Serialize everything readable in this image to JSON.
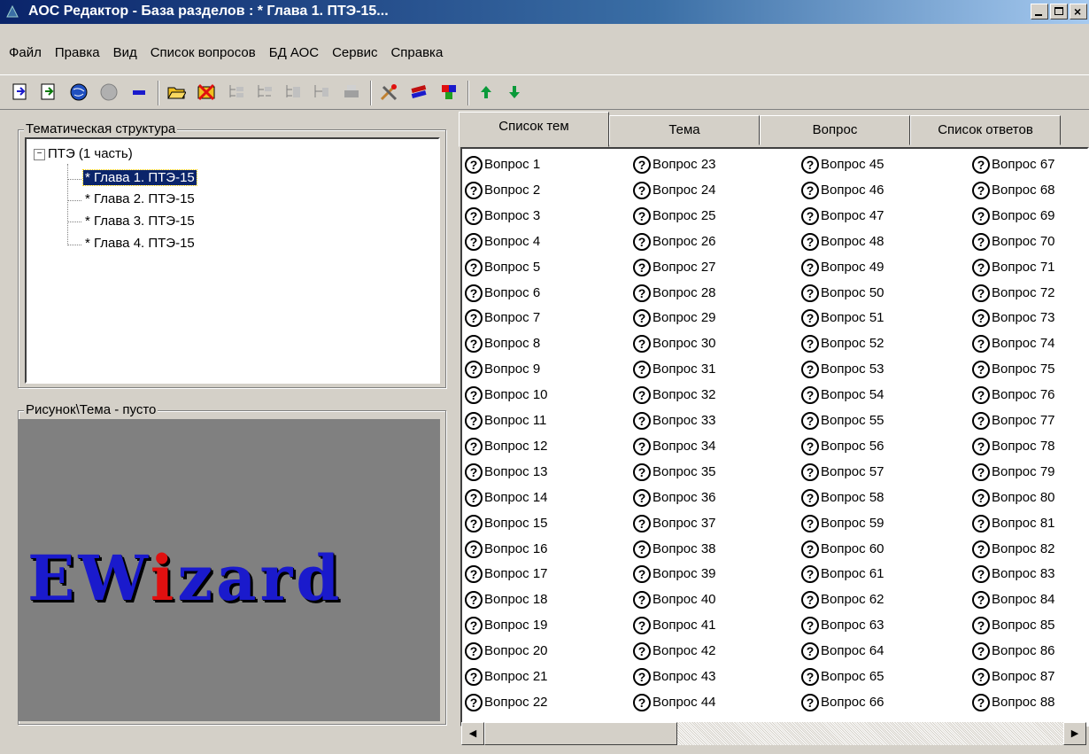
{
  "window": {
    "title": "АОС Редактор - База разделов : * Глава 1. ПТЭ-15..."
  },
  "menu": [
    "Файл",
    "Правка",
    "Вид",
    "Список вопросов",
    "БД АОС",
    "Сервис",
    "Справка"
  ],
  "toolbar_icons": [
    "import-icon",
    "export-icon",
    "globe-icon",
    "globe-disabled-icon",
    "minus-icon",
    "open-folder-icon",
    "delete-icon",
    "tree-add-icon",
    "tree-move-icon",
    "tree-indent-icon",
    "tree-outdent-icon",
    "print-icon",
    "tools-icon",
    "books-icon",
    "colors-icon",
    "arrow-up-icon",
    "arrow-down-icon"
  ],
  "left": {
    "tree_caption": "Тематическая структура",
    "tree": {
      "root": "ПТЭ (1 часть)",
      "children": [
        "* Глава 1. ПТЭ-15",
        "* Глава 2. ПТЭ-15",
        "* Глава 3. ПТЭ-15",
        "* Глава 4. ПТЭ-15"
      ],
      "selected_index": 0
    },
    "picture_caption": "Рисунок\\Тема  - пусто",
    "logo": {
      "part1": "EW",
      "part2": "i",
      "part3": "zard"
    }
  },
  "tabs": [
    "Список тем",
    "Тема",
    "Вопрос",
    "Список ответов"
  ],
  "active_tab": 0,
  "questions": [
    "Вопрос 1",
    "Вопрос 2",
    "Вопрос 3",
    "Вопрос 4",
    "Вопрос 5",
    "Вопрос 6",
    "Вопрос 7",
    "Вопрос 8",
    "Вопрос 9",
    "Вопрос 10",
    "Вопрос 11",
    "Вопрос 12",
    "Вопрос 13",
    "Вопрос 14",
    "Вопрос 15",
    "Вопрос 16",
    "Вопрос 17",
    "Вопрос 18",
    "Вопрос 19",
    "Вопрос 20",
    "Вопрос 21",
    "Вопрос 22",
    "Вопрос 23",
    "Вопрос 24",
    "Вопрос 25",
    "Вопрос 26",
    "Вопрос 27",
    "Вопрос 28",
    "Вопрос 29",
    "Вопрос 30",
    "Вопрос 31",
    "Вопрос 32",
    "Вопрос 33",
    "Вопрос 34",
    "Вопрос 35",
    "Вопрос 36",
    "Вопрос 37",
    "Вопрос 38",
    "Вопрос 39",
    "Вопрос 40",
    "Вопрос 41",
    "Вопрос 42",
    "Вопрос 43",
    "Вопрос 44",
    "Вопрос 45",
    "Вопрос 46",
    "Вопрос 47",
    "Вопрос 48",
    "Вопрос 49",
    "Вопрос 50",
    "Вопрос 51",
    "Вопрос 52",
    "Вопрос 53",
    "Вопрос 54",
    "Вопрос 55",
    "Вопрос 56",
    "Вопрос 57",
    "Вопрос 58",
    "Вопрос 59",
    "Вопрос 60",
    "Вопрос 61",
    "Вопрос 62",
    "Вопрос 63",
    "Вопрос 64",
    "Вопрос 65",
    "Вопрос 66",
    "Вопрос 67",
    "Вопрос 68",
    "Вопрос 69",
    "Вопрос 70",
    "Вопрос 71",
    "Вопрос 72",
    "Вопрос 73",
    "Вопрос 74",
    "Вопрос 75",
    "Вопрос 76",
    "Вопрос 77",
    "Вопрос 78",
    "Вопрос 79",
    "Вопрос 80",
    "Вопрос 81",
    "Вопрос 82",
    "Вопрос 83",
    "Вопрос 84",
    "Вопрос 85",
    "Вопрос 86",
    "Вопрос 87",
    "Вопрос 88"
  ],
  "question_icon": "question-circle-icon",
  "question_icon_glyph": "?"
}
